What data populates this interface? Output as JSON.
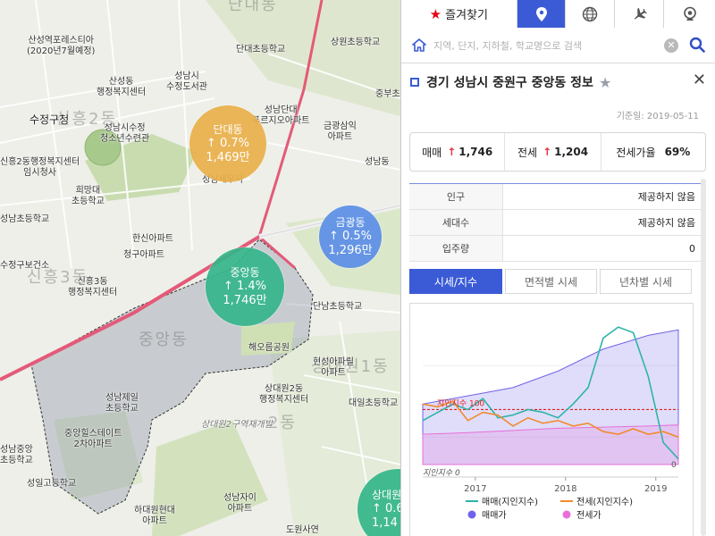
{
  "map": {
    "labels": [
      {
        "id": "forest",
        "text": "산성역포레스티아",
        "sub": "(2020년7월예정)"
      },
      {
        "id": "sanseong",
        "text": "산성동",
        "sub": "행정복지센터"
      },
      {
        "id": "library",
        "text": "성남시",
        "sub": "수정도서관"
      },
      {
        "id": "dandae-school",
        "text": "단대초등학교"
      },
      {
        "id": "sangwon-school",
        "text": "상원초등학교"
      },
      {
        "id": "sujeong-office",
        "text": "수정구청"
      },
      {
        "id": "sujeong-youth",
        "text": "성남시수정",
        "sub": "청소년수련관"
      },
      {
        "id": "dandae-prugio",
        "text": "성남단대",
        "sub": "푸르지오아파트"
      },
      {
        "id": "jungbu",
        "text": "중부초"
      },
      {
        "id": "sinheung2",
        "text": "신흥2동행정복지센터",
        "sub": "임시청사"
      },
      {
        "id": "geumgwang-sam",
        "text": "금광삼익",
        "sub": "아파트"
      },
      {
        "id": "huimang",
        "text": "희망대",
        "sub": "초등학교"
      },
      {
        "id": "seongnam-el",
        "text": "성남동"
      },
      {
        "id": "tax",
        "text": "성남세무서"
      },
      {
        "id": "seongnam-school",
        "text": "성남초등학교"
      },
      {
        "id": "hansin",
        "text": "한신아파트"
      },
      {
        "id": "cheongu",
        "text": "청구아파트"
      },
      {
        "id": "health",
        "text": "수정구보건소"
      },
      {
        "id": "sinheung3",
        "text": "신흥3동",
        "sub": "행정복지센터"
      },
      {
        "id": "dannam",
        "text": "단남초등학교"
      },
      {
        "id": "haeoreum",
        "text": "해오름공원"
      },
      {
        "id": "hyeonseong",
        "text": "현성아파릴",
        "sub": "아파트"
      },
      {
        "id": "daeil",
        "text": "대일초등학교"
      },
      {
        "id": "sangdaewon2",
        "text": "상대원2동",
        "sub": "행정복지센터"
      },
      {
        "id": "jeil",
        "text": "성남제일",
        "sub": "초등학교"
      },
      {
        "id": "estate",
        "text": "중앙힐스테이트",
        "sub": "2차아파트"
      },
      {
        "id": "jungang-school",
        "text": "성남중앙",
        "sub": "초등학교"
      },
      {
        "id": "seongil",
        "text": "성일고등학교"
      },
      {
        "id": "hadaewon",
        "text": "하대원현대",
        "sub": "아파트"
      },
      {
        "id": "jai",
        "text": "성남자이",
        "sub": "아파트"
      },
      {
        "id": "dowon",
        "text": "도원사연"
      },
      {
        "id": "redevelop",
        "text": "상대원2구역재개발"
      }
    ],
    "districts": [
      {
        "id": "sinheung2dong",
        "text": "신흥2동"
      },
      {
        "id": "sinheung3dong",
        "text": "신흥3동"
      },
      {
        "id": "jungangdong",
        "text": "중앙동"
      },
      {
        "id": "danggu",
        "text": "단대동"
      },
      {
        "id": "sangdaewon1",
        "text": "상대원1동"
      },
      {
        "id": "sangdaewon2dong",
        "text": "2동"
      }
    ],
    "bubbles": [
      {
        "id": "dandae",
        "name": "단대동",
        "change": "0.7%",
        "count": "1,469만",
        "color": "#e9b04a"
      },
      {
        "id": "geumgwang",
        "name": "금광동",
        "change": "0.5%",
        "count": "1,296만",
        "color": "#5b8ee6"
      },
      {
        "id": "jungang",
        "name": "중앙동",
        "change": "1.4%",
        "count": "1,746만",
        "color": "#34b58a"
      },
      {
        "id": "sangdae",
        "name": "상대원",
        "change": "0.6",
        "count": "1,14",
        "color": "#34b58a"
      }
    ],
    "road_label": "산성대로"
  },
  "panel": {
    "tabs": {
      "favorites_label": "즐겨찾기",
      "icons": [
        "location-pin-icon",
        "globe-icon",
        "airplane-icon",
        "webcam-icon"
      ]
    },
    "search": {
      "placeholder": "지역, 단지, 지하철, 학교명으로 검색",
      "clear_glyph": "✕"
    },
    "info": {
      "title": "경기 성남시 중원구 중앙동 정보",
      "reference_date": "기준일: 2019-05-11",
      "close_glyph": "✕"
    },
    "prices": {
      "sale_label": "매매",
      "sale_value": "1,746",
      "jeonse_label": "전세",
      "jeonse_value": "1,204",
      "ratio_label": "전세가율",
      "ratio_value": "69%",
      "arrow": "↑"
    },
    "stats": [
      {
        "key": "인구",
        "value": "제공하지 않음"
      },
      {
        "key": "세대수",
        "value": "제공하지 않음"
      },
      {
        "key": "입주량",
        "value": "0"
      }
    ],
    "bottom_tabs": [
      "시세/지수",
      "면적별 시세",
      "년차별 시세"
    ],
    "active_bottom_tab": 0
  },
  "chart_data": {
    "type": "line",
    "x_ticks": [
      "2017",
      "2018",
      "2019"
    ],
    "x_range": [
      "2016-06",
      "2019-04"
    ],
    "annotations": [
      "지인지수 100",
      "지인지수 0",
      "0"
    ],
    "reference_line": {
      "label": "지인지수 100",
      "value": 100,
      "color": "#e02020"
    },
    "series": [
      {
        "name": "매매(지인지수)",
        "color": "#2fb3a8",
        "kind": "line",
        "x": [
          "2016-06",
          "2016-08",
          "2016-10",
          "2016-12",
          "2017-02",
          "2017-04",
          "2017-06",
          "2017-08",
          "2017-10",
          "2017-12",
          "2018-02",
          "2018-04",
          "2018-06",
          "2018-08",
          "2018-10",
          "2018-12",
          "2019-02",
          "2019-04"
        ],
        "values": [
          80,
          95,
          110,
          100,
          120,
          85,
          90,
          100,
          95,
          85,
          110,
          140,
          230,
          250,
          240,
          160,
          40,
          10
        ]
      },
      {
        "name": "전세(지인지수)",
        "color": "#f28a2e",
        "kind": "line",
        "x": [
          "2016-06",
          "2016-08",
          "2016-10",
          "2016-12",
          "2017-02",
          "2017-04",
          "2017-06",
          "2017-08",
          "2017-10",
          "2017-12",
          "2018-02",
          "2018-04",
          "2018-06",
          "2018-08",
          "2018-10",
          "2018-12",
          "2019-02",
          "2019-04"
        ],
        "values": [
          110,
          105,
          115,
          80,
          95,
          90,
          70,
          85,
          75,
          80,
          70,
          75,
          60,
          55,
          65,
          55,
          60,
          50
        ]
      },
      {
        "name": "매매가",
        "color": "#6e63e8",
        "kind": "area",
        "x": [
          "2016-06",
          "2016-12",
          "2017-06",
          "2017-12",
          "2018-06",
          "2018-12",
          "2019-04"
        ],
        "values": [
          110,
          125,
          140,
          170,
          210,
          235,
          245
        ]
      },
      {
        "name": "전세가",
        "color": "#e86fd8",
        "kind": "area",
        "x": [
          "2016-06",
          "2016-12",
          "2017-06",
          "2017-12",
          "2018-06",
          "2018-12",
          "2019-04"
        ],
        "values": [
          55,
          58,
          62,
          66,
          68,
          70,
          72
        ]
      }
    ],
    "legend": {
      "placement": "bottom",
      "labels": [
        "매매(지인지수)",
        "전세(지인지수)",
        "매매가",
        "전세가"
      ]
    }
  }
}
